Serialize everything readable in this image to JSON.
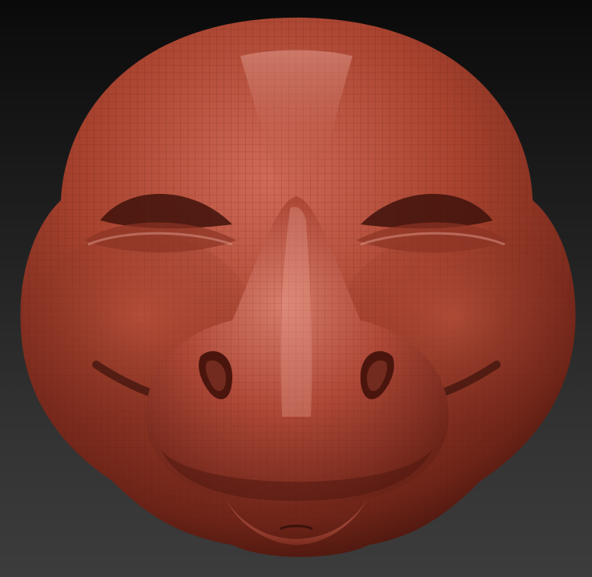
{
  "scene": {
    "subject": "sculpted-head-clay-model",
    "material_color": "#b04a3a",
    "material_shadow": "#5a1a12",
    "material_highlight": "#e8a093",
    "background_top": "#0a0a0a",
    "background_bottom": "#3c3c3c",
    "wireframe_visible": true
  }
}
